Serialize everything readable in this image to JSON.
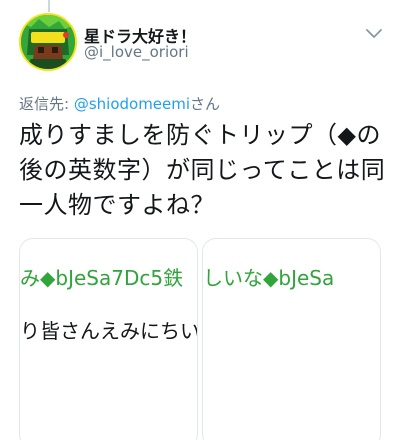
{
  "user": {
    "display_name": "星ドラ大好き！",
    "handle": "@i_love_oriori",
    "avatar_icon": "game-logo-avatar"
  },
  "reply": {
    "prefix": "返信先: ",
    "mention": "@shiodomeemi",
    "suffix": "さん"
  },
  "tweet": {
    "text": "成りすましを防ぐトリップ（◆の後の英数字）が同じってことは同一人物ですよね？"
  },
  "media_cards": [
    {
      "line1": "み◆bJeSa7Dc5",
      "line1_glyph": "鉄",
      "line2": "り皆さんえみにちい？"
    },
    {
      "line1": "しいな◆bJeSa"
    }
  ],
  "colors": {
    "mention": "#1da1f2",
    "secondary_text": "#657786",
    "trip_green": "#2fa53a"
  }
}
